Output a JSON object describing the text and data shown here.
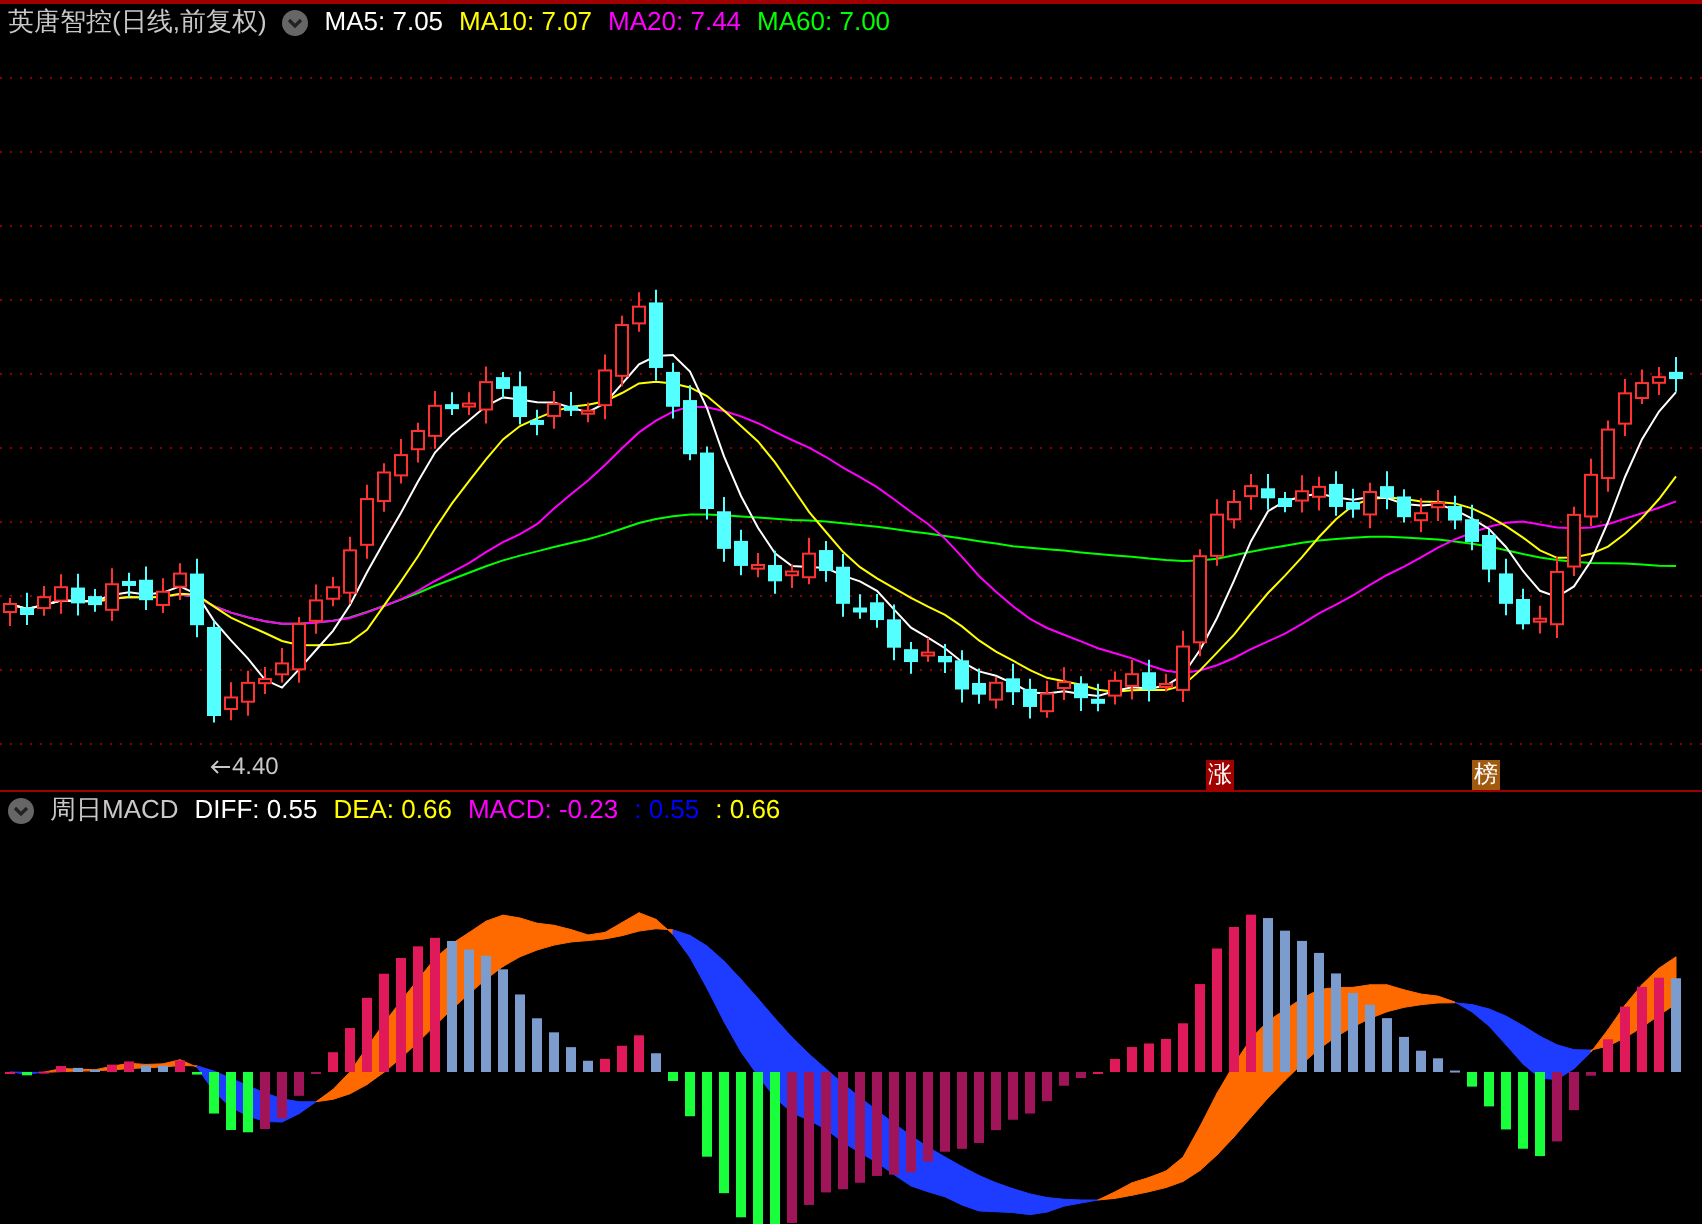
{
  "price_panel": {
    "title": "英唐智控(日线,前复权)",
    "legend": [
      {
        "label": "MA5: 7.05",
        "color": "#ffffff"
      },
      {
        "label": "MA10: 7.07",
        "color": "#ffff00"
      },
      {
        "label": "MA20: 7.44",
        "color": "#ff00ff"
      },
      {
        "label": "MA60: 7.00",
        "color": "#00ff00"
      }
    ],
    "low_marker": "4.40",
    "badges": [
      {
        "label": "涨",
        "color": "#a00000"
      },
      {
        "label": "榜",
        "color": "#a05a10"
      }
    ]
  },
  "macd_panel": {
    "title": "周日MACD",
    "legend": [
      {
        "label": "DIFF: 0.55",
        "color": "#ffffff"
      },
      {
        "label": "DEA: 0.66",
        "color": "#ffff00"
      },
      {
        "label": "MACD: -0.23",
        "color": "#ff00ff"
      },
      {
        "label": ": 0.55",
        "color": "#0000ff"
      },
      {
        "label": ": 0.66",
        "color": "#ffff00"
      }
    ]
  }
}
